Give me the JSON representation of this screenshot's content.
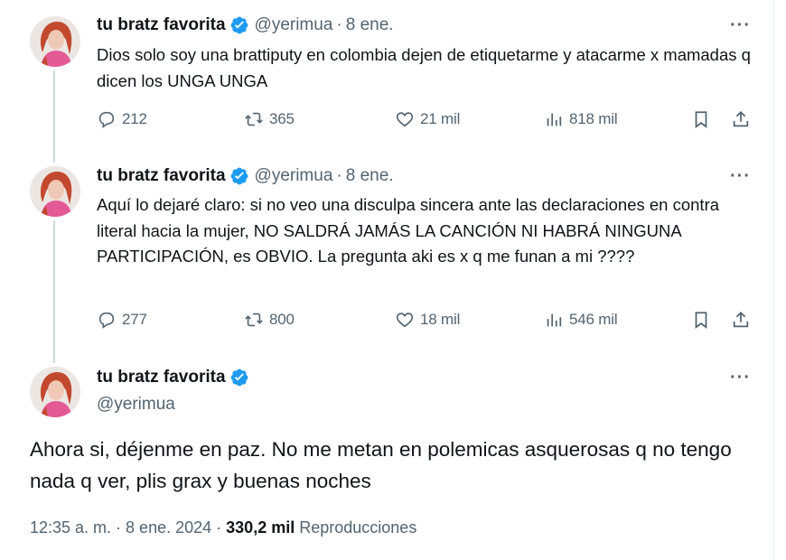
{
  "tweets": [
    {
      "name": "tu bratz favorita",
      "handle": "@yerimua",
      "separator": "·",
      "date": "8 ene.",
      "text": "Dios solo soy una brattiputy en colombia dejen de etiquetarme y atacarme x mamadas q dicen los UNGA UNGA",
      "replies": "212",
      "reposts": "365",
      "likes": "21 mil",
      "views": "818 mil"
    },
    {
      "name": "tu bratz favorita",
      "handle": "@yerimua",
      "separator": "·",
      "date": "8 ene.",
      "text": "Aquí lo dejaré claro: si no veo una disculpa sincera ante las declaraciones en contra literal hacia la mujer, NO SALDRÁ JAMÁS LA CANCIÓN NI HABRÁ NINGUNA PARTICIPACIÓN, es OBVIO. La pregunta aki es x q me funan a mi ????",
      "replies": "277",
      "reposts": "800",
      "likes": "18 mil",
      "views": "546 mil"
    }
  ],
  "main_tweet": {
    "name": "tu bratz favorita",
    "handle": "@yerimua",
    "text": "Ahora si, déjenme en paz. No me metan en polemicas asquerosas q no tengo nada q ver, plis grax y buenas noches",
    "timestamp": "12:35 a. m. · 8 ene. 2024 ·",
    "views_count": "330,2 mil",
    "views_label": "Reproducciones"
  },
  "more_label": "···",
  "colors": {
    "verified": "#1d9bf0",
    "secondary_text": "#536471",
    "thread_line": "#cfd9de"
  },
  "icons": [
    "reply-icon",
    "repost-icon",
    "like-icon",
    "views-icon",
    "bookmark-icon",
    "share-icon",
    "verified-badge-icon",
    "more-icon"
  ]
}
